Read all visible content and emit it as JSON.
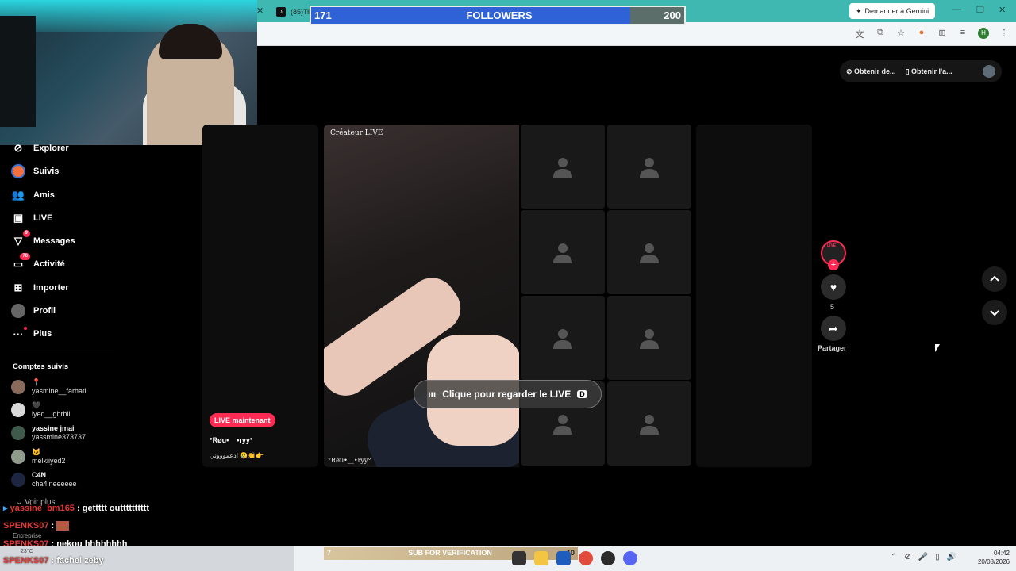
{
  "browser": {
    "tab_title": "(85)Tik",
    "gemini_label": "Demander à Gemini",
    "profile_initial": "H"
  },
  "followers_goal": {
    "current": "171",
    "title": "FOLLOWERS",
    "goal": "200",
    "progress_fraction": 0.855
  },
  "sidebar": {
    "nav": [
      {
        "label": "Explorer",
        "icon": "compass-icon"
      },
      {
        "label": "Suivis",
        "icon": "following-icon"
      },
      {
        "label": "Amis",
        "icon": "friends-icon"
      },
      {
        "label": "LIVE",
        "icon": "live-icon"
      },
      {
        "label": "Messages",
        "icon": "messages-icon",
        "badge": "9"
      },
      {
        "label": "Activité",
        "icon": "activity-icon",
        "badge": "76"
      },
      {
        "label": "Importer",
        "icon": "upload-icon"
      },
      {
        "label": "Profil",
        "icon": "profile-icon"
      },
      {
        "label": "Plus",
        "icon": "more-icon"
      }
    ],
    "followed_title": "Comptes suivis",
    "followed": [
      {
        "name": "📍",
        "handle": "yasmine__farhatii"
      },
      {
        "name": "🖤",
        "handle": "iyed__ghrbii"
      },
      {
        "name": "yassine jmai",
        "handle": "yassmine373737"
      },
      {
        "name": "🐱",
        "handle": "melkiiyed2"
      },
      {
        "name": "C4N",
        "handle": "cha4ineeeeee"
      }
    ],
    "voir_plus": "Voir plus",
    "entreprise": "Entreprise"
  },
  "chat": [
    {
      "user": "yassine_bm165",
      "message": ": gettttt outttttttttt"
    },
    {
      "user": "SPENKS07",
      "message": ":"
    },
    {
      "user": "SPENKS07",
      "message": ": nekou hhhhhhhh"
    },
    {
      "user": "SPENKS07",
      "message": ": fachel zeby"
    }
  ],
  "top_actions": {
    "obtain_desktop": "Obtenir de...",
    "obtain_app": "Obtenir l'a..."
  },
  "live": {
    "badge": "LIVE maintenant",
    "host_name": "°Røu•__•ryy°",
    "host_desc": "ادعموووني 😢👏👉",
    "creator_label": "Créateur LIVE",
    "video_name": "°Røu•__•ryy°",
    "watch_label": "Clique pour regarder le LIVE",
    "watch_key": "D",
    "avatar_live": "LIVE",
    "likes": "5",
    "share": "Partager"
  },
  "taskbar": {
    "sub_count": "7",
    "sub_text": "SUB FOR VERIFICATION",
    "sub_goal": "10",
    "weather": "23°C",
    "time": "04:42",
    "date": "20/08/2026"
  },
  "colors": {
    "accent": "#fe2c55",
    "followers_fill": "#2f62d6",
    "chrome": "#3fb8b2"
  }
}
